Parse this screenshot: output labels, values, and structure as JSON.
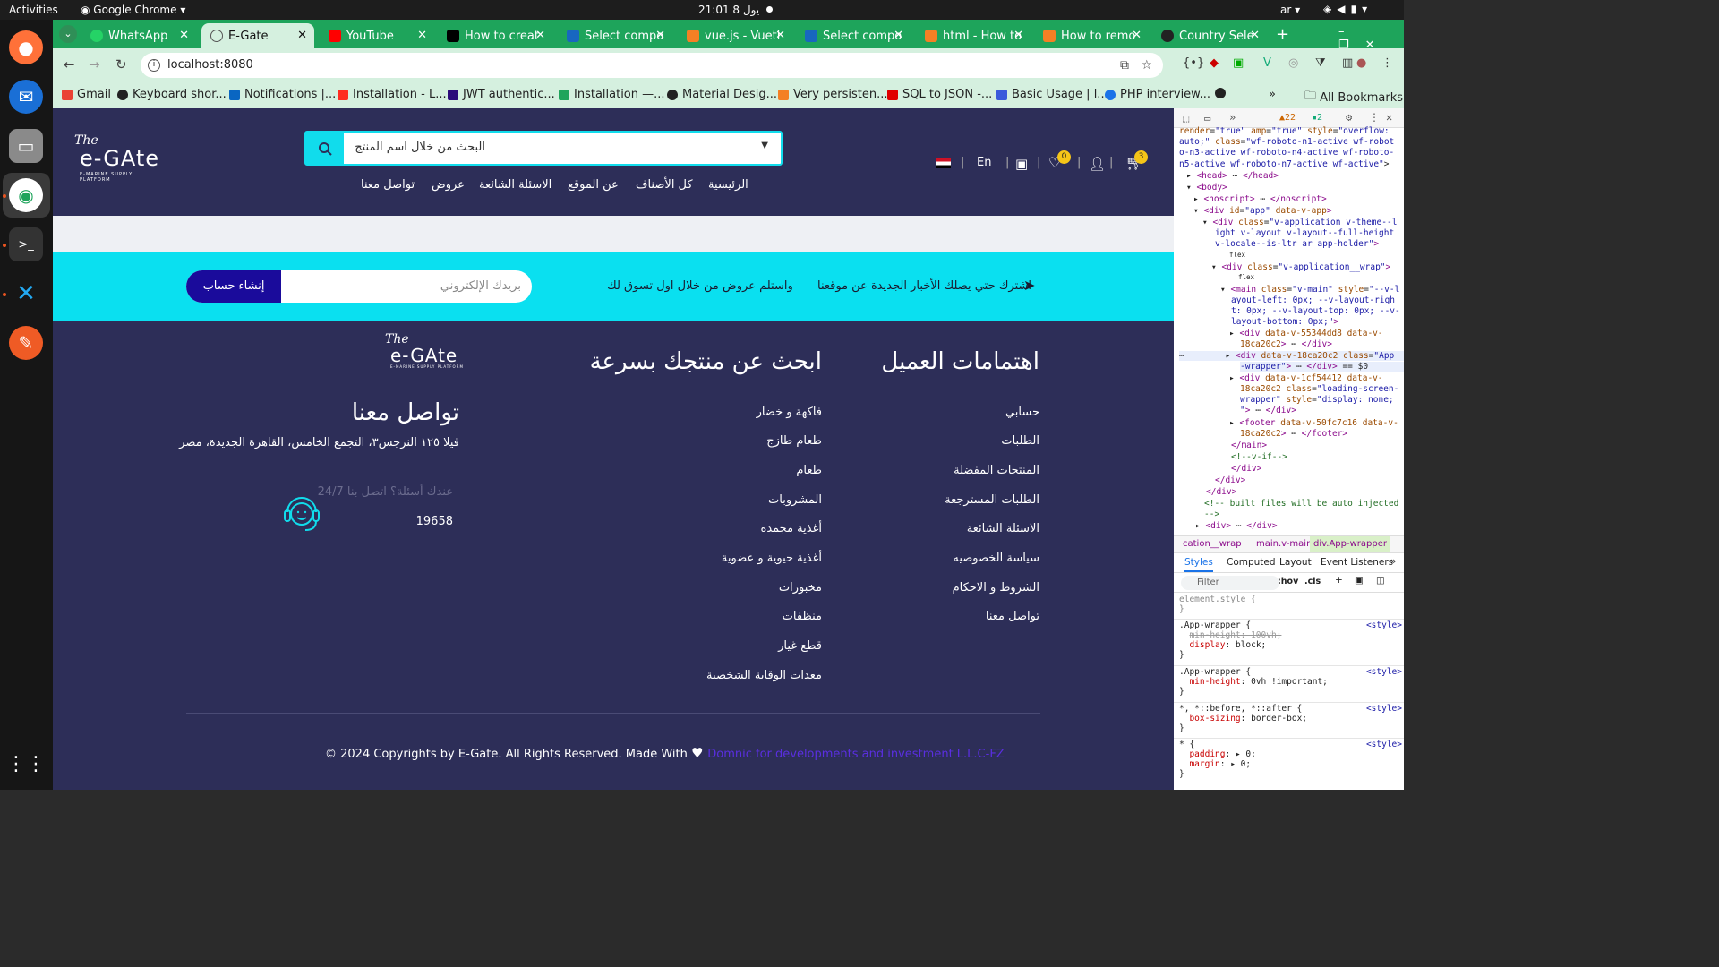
{
  "os": {
    "activities": "Activities",
    "app_name": "Google Chrome",
    "clock": "يول 8  21:01",
    "lang": "ar"
  },
  "tabs": [
    {
      "title": "WhatsApp",
      "color": "#25d366"
    },
    {
      "title": "E-Gate",
      "color": "#555555"
    },
    {
      "title": "YouTube",
      "color": "#ff0000"
    },
    {
      "title": "How to creat",
      "color": "#000000"
    },
    {
      "title": "Select compo",
      "color": "#1867c0"
    },
    {
      "title": "vue.js - Vueti",
      "color": "#f48024"
    },
    {
      "title": "Select compo",
      "color": "#1867c0"
    },
    {
      "title": "html - How to",
      "color": "#f48024"
    },
    {
      "title": "How to remo",
      "color": "#f48024"
    },
    {
      "title": "Country Sele",
      "color": "#222222"
    }
  ],
  "toolbar": {
    "url": "localhost:8080"
  },
  "bookmarks": [
    {
      "label": "Gmail",
      "color": "#ea4335"
    },
    {
      "label": "Keyboard shor...",
      "color": "#222222"
    },
    {
      "label": "Notifications |...",
      "color": "#0a66c2"
    },
    {
      "label": "Installation - L...",
      "color": "#ff2d20"
    },
    {
      "label": "JWT authentic...",
      "color": "#2b0b7a"
    },
    {
      "label": "Installation —...",
      "color": "#1ea45b"
    },
    {
      "label": "Material Desig...",
      "color": "#222222"
    },
    {
      "label": "Very persisten...",
      "color": "#f48024"
    },
    {
      "label": "SQL to JSON -...",
      "color": "#e00000"
    },
    {
      "label": "Basic Usage | l...",
      "color": "#3b5bdb"
    },
    {
      "label": "PHP interview...",
      "color": "#1a73e8"
    }
  ],
  "all_bookmarks": "All Bookmarks",
  "site": {
    "logo": {
      "the": "The",
      "name": "e-GAte",
      "sub": "E-MARINE SUPPLY PLATFORM"
    },
    "search_placeholder": "البحث من خلال اسم المنتج",
    "menu": [
      "الرئيسية",
      "كل الأصناف",
      "عن الموقع",
      "الاسئلة الشائعة",
      "عروض",
      "تواصل معنا"
    ],
    "lang_switch": "En",
    "wishlist_count": "0",
    "cart_count": "3",
    "newsletter": {
      "line1": "اشترك حتي يصلك الأخبار الجديدة عن موقعنا",
      "line2": "واستلم عروض من خلال اول تسوق لك",
      "email_placeholder": "بريدك الإلكتروني",
      "button": "إنشاء حساب"
    },
    "footer": {
      "col1_title": "اهتمامات العميل",
      "col1_links": [
        "حسابي",
        "الطلبات",
        "المنتجات المفضلة",
        "الطلبات المسترجعة",
        "الاسئلة الشائعة",
        "سياسة الخصوصيه",
        "الشروط و الاحكام",
        "تواصل معنا"
      ],
      "col2_title": "ابحث عن منتجك بسرعة",
      "col2_links": [
        "فاكهة و خضار",
        "طعام طازج",
        "طعام",
        "المشروبات",
        "أغذية مجمدة",
        "أغذية حيوية و عضوية",
        "مخبوزات",
        "منظفات",
        "قطع غيار",
        "معدات الوقاية الشخصية"
      ],
      "contact_title": "تواصل معنا",
      "address": "فيلا ١٢٥ النرجس٣، التجمع الخامس، القاهرة الجديدة، مصر",
      "question": "عندك أسئلة؟ اتصل بنا 24/7",
      "phone": "19658",
      "copyright": "© 2024 Copyrights by E-Gate. All Rights Reserved. Made With",
      "company": "Domnic for developments and investment L.L.C-FZ"
    }
  },
  "devtools": {
    "warnings": "22",
    "messages": "2",
    "crumbs": [
      "cation__wrap",
      "main.v-main",
      "div.App-wrapper"
    ],
    "style_tabs": [
      "Styles",
      "Computed",
      "Layout",
      "Event Listeners"
    ],
    "filter": "Filter",
    "hov": ":hov",
    "cls": ".cls"
  },
  "colors": {
    "chrome_green": "#1ea45b",
    "site_navy": "#2d2e58",
    "accent_cyan": "#0ae0f0",
    "cta_blue": "#1a0b9b"
  }
}
